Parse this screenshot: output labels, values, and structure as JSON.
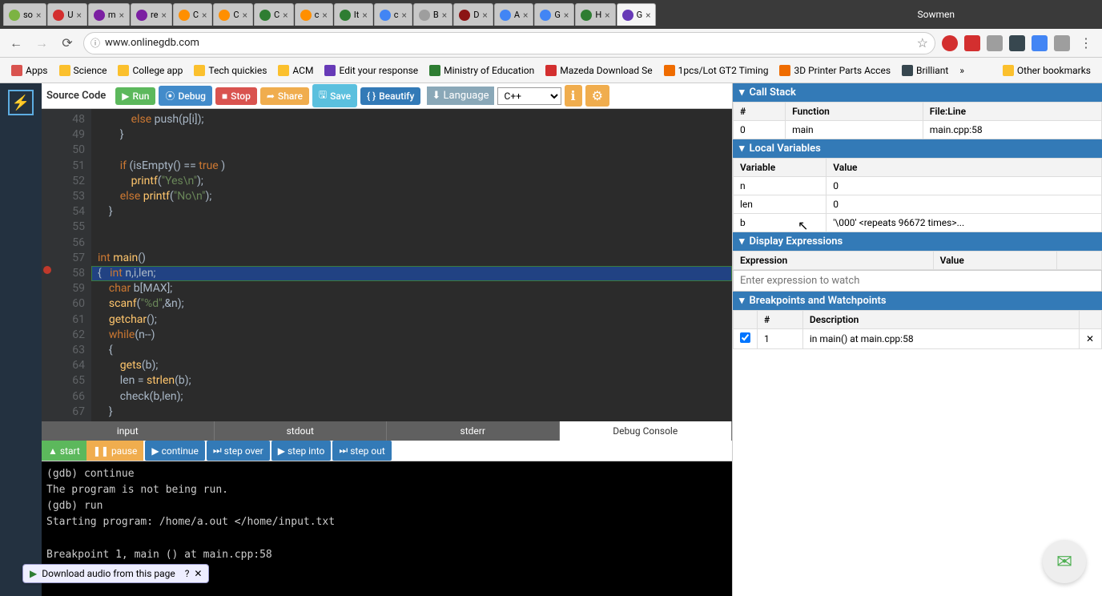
{
  "browser": {
    "profile": "Sowmen",
    "tabs": [
      {
        "label": "so",
        "close": "×",
        "fav": "#7cb342"
      },
      {
        "label": "U",
        "close": "×",
        "fav": "#d32f2f"
      },
      {
        "label": "m",
        "close": "×",
        "fav": "#7b1fa2"
      },
      {
        "label": "re",
        "close": "×",
        "fav": "#7b1fa2"
      },
      {
        "label": "C",
        "close": "×",
        "fav": "#ff8f00"
      },
      {
        "label": "C",
        "close": "×",
        "fav": "#ff8f00"
      },
      {
        "label": "C",
        "close": "×",
        "fav": "#2e7d32"
      },
      {
        "label": "c",
        "close": "×",
        "fav": "#ff8f00"
      },
      {
        "label": "It",
        "close": "×",
        "fav": "#2e7d32"
      },
      {
        "label": "c",
        "close": "×",
        "fav": "#4285f4"
      },
      {
        "label": "B",
        "close": "×",
        "fav": "#9e9e9e"
      },
      {
        "label": "D",
        "close": "×",
        "fav": "#8c1515"
      },
      {
        "label": "A",
        "close": "×",
        "fav": "#4285f4"
      },
      {
        "label": "G",
        "close": "×",
        "fav": "#4285f4"
      },
      {
        "label": "H",
        "close": "×",
        "fav": "#2e7d32"
      },
      {
        "label": "G",
        "close": "×",
        "fav": "#673ab7",
        "active": true
      }
    ],
    "nav": {
      "url": "www.onlinegdb.com",
      "info_icon": "ⓘ",
      "star": "☆"
    },
    "bookmarks": [
      {
        "label": "Apps",
        "color": "#d9534f"
      },
      {
        "label": "Science",
        "color": "#fbc02d"
      },
      {
        "label": "College app",
        "color": "#fbc02d"
      },
      {
        "label": "Tech quickies",
        "color": "#fbc02d"
      },
      {
        "label": "ACM",
        "color": "#fbc02d"
      },
      {
        "label": "Edit your response",
        "color": "#673ab7"
      },
      {
        "label": "Ministry of Education",
        "color": "#2e7d32"
      },
      {
        "label": "Mazeda Download Se",
        "color": "#d32f2f"
      },
      {
        "label": "1pcs/Lot GT2 Timing",
        "color": "#ef6c00"
      },
      {
        "label": "3D Printer Parts Acces",
        "color": "#ef6c00"
      },
      {
        "label": "Brilliant",
        "color": "#37474f"
      },
      {
        "label": "»",
        "color": "transparent"
      },
      {
        "label": "Other bookmarks",
        "color": "#fbc02d"
      }
    ]
  },
  "toolbar": {
    "source_label": "Source Code",
    "run": "Run",
    "debug": "Debug",
    "stop": "Stop",
    "share": "Share",
    "save": "Save",
    "beautify": "Beautify",
    "lang_label": "Language",
    "lang_value": "C++"
  },
  "editor": {
    "lines": [
      {
        "n": 48,
        "html": "            <span class='kw'>else</span> push(p[i]);"
      },
      {
        "n": 49,
        "html": "        }"
      },
      {
        "n": 50,
        "html": ""
      },
      {
        "n": 51,
        "html": "        <span class='kw'>if</span> (isEmpty() == <span class='kw'>true</span> )"
      },
      {
        "n": 52,
        "html": "            <span class='fn'>printf</span>(<span class='str'>\"Yes</span><span class='ec'>\\n</span><span class='str'>\"</span>);"
      },
      {
        "n": 53,
        "html": "        <span class='kw'>else</span> <span class='fn'>printf</span>(<span class='str'>\"No</span><span class='ec'>\\n</span><span class='str'>\"</span>);"
      },
      {
        "n": 54,
        "html": "    }"
      },
      {
        "n": 55,
        "html": ""
      },
      {
        "n": 56,
        "html": ""
      },
      {
        "n": 57,
        "html": "<span class='ty'>int</span> <span class='fn'>main</span>()"
      },
      {
        "n": 58,
        "html": "{   <span class='ty'>int</span> n,i,len;",
        "bp": true,
        "hl": true
      },
      {
        "n": 59,
        "html": "    <span class='ty'>char</span> b[MAX];"
      },
      {
        "n": 60,
        "html": "    <span class='fn'>scanf</span>(<span class='str'>\"%d\"</span>,&n);"
      },
      {
        "n": 61,
        "html": "    <span class='fn'>getchar</span>();"
      },
      {
        "n": 62,
        "html": "    <span class='kw'>while</span>(n--)"
      },
      {
        "n": 63,
        "html": "    {"
      },
      {
        "n": 64,
        "html": "        <span class='fn'>gets</span>(b);"
      },
      {
        "n": 65,
        "html": "        len = <span class='fn'>strlen</span>(b);"
      },
      {
        "n": 66,
        "html": "        check(b,len);"
      },
      {
        "n": 67,
        "html": "    }"
      }
    ]
  },
  "console": {
    "tabs": {
      "input": "input",
      "stdout": "stdout",
      "stderr": "stderr",
      "debug": "Debug Console"
    },
    "controls": {
      "start": "start",
      "pause": "pause",
      "continue": "continue",
      "step_over": "step over",
      "step_into": "step into",
      "step_out": "step out"
    },
    "output": "(gdb) continue\nThe program is not being run.\n(gdb) run\nStarting program: /home/a.out </home/input.txt\n\nBreakpoint 1, main () at main.cpp:58"
  },
  "panels": {
    "call_stack": {
      "title": "Call Stack",
      "cols": [
        "#",
        "Function",
        "File:Line"
      ],
      "rows": [
        [
          "0",
          "main",
          "main.cpp:58"
        ]
      ]
    },
    "local_vars": {
      "title": "Local Variables",
      "cols": [
        "Variable",
        "Value"
      ],
      "rows": [
        [
          "n",
          "0"
        ],
        [
          "len",
          "0"
        ],
        [
          "b",
          "'\\000' <repeats 96672 times>..."
        ]
      ]
    },
    "expressions": {
      "title": "Display Expressions",
      "cols": [
        "Expression",
        "Value",
        ""
      ],
      "placeholder": "Enter expression to watch"
    },
    "breakpoints": {
      "title": "Breakpoints and Watchpoints",
      "cols": [
        "",
        "#",
        "Description",
        ""
      ],
      "rows": [
        [
          "✓",
          "1",
          "in main() at main.cpp:58",
          "✕"
        ]
      ]
    }
  },
  "misc": {
    "audio_dl": "Download audio from this page"
  }
}
